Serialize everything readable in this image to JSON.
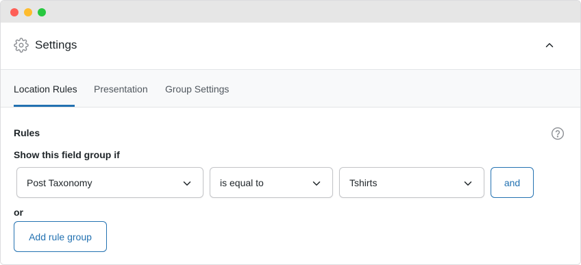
{
  "window": {
    "controls": [
      "close",
      "minimize",
      "maximize"
    ]
  },
  "panel": {
    "title": "Settings",
    "icon": "gear-icon",
    "collapse_icon": "chevron-up-icon"
  },
  "tabs": [
    {
      "label": "Location Rules",
      "active": true
    },
    {
      "label": "Presentation",
      "active": false
    },
    {
      "label": "Group Settings",
      "active": false
    }
  ],
  "rules": {
    "heading": "Rules",
    "help_icon": "question-circle-icon",
    "condition_label": "Show this field group if",
    "rule": {
      "param": "Post Taxonomy",
      "operator": "is equal to",
      "value": "Tshirts"
    },
    "and_label": "and",
    "or_label": "or",
    "add_group_label": "Add rule group"
  },
  "colors": {
    "accent": "#2271b1",
    "text": "#1d2327",
    "muted": "#50575e",
    "border": "#c3c4c7",
    "tab_bg": "#f8f9fa"
  }
}
